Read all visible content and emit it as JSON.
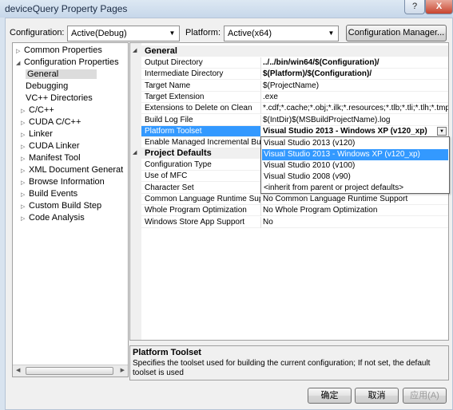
{
  "window": {
    "title": "deviceQuery Property Pages",
    "help_label": "?",
    "close_label": "X"
  },
  "toolbar": {
    "configuration_label": "Configuration:",
    "configuration_value": "Active(Debug)",
    "platform_label": "Platform:",
    "platform_value": "Active(x64)",
    "config_manager_label": "Configuration Manager..."
  },
  "tree": {
    "items": [
      {
        "label": "Common Properties",
        "expander": "▷"
      },
      {
        "label": "Configuration Properties",
        "expander": "◢"
      },
      {
        "label": "General"
      },
      {
        "label": "Debugging"
      },
      {
        "label": "VC++ Directories"
      },
      {
        "label": "C/C++",
        "expander": "▷"
      },
      {
        "label": "CUDA C/C++",
        "expander": "▷"
      },
      {
        "label": "Linker",
        "expander": "▷"
      },
      {
        "label": "CUDA Linker",
        "expander": "▷"
      },
      {
        "label": "Manifest Tool",
        "expander": "▷"
      },
      {
        "label": "XML Document Generat",
        "expander": "▷"
      },
      {
        "label": "Browse Information",
        "expander": "▷"
      },
      {
        "label": "Build Events",
        "expander": "▷"
      },
      {
        "label": "Custom Build Step",
        "expander": "▷"
      },
      {
        "label": "Code Analysis",
        "expander": "▷"
      }
    ],
    "selected": "General"
  },
  "grid": {
    "categories": [
      {
        "name": "General",
        "expander": "◢"
      },
      {
        "name": "Project Defaults",
        "expander": "◢"
      }
    ],
    "general_rows": [
      {
        "name": "Output Directory",
        "value": "../../bin/win64/$(Configuration)/"
      },
      {
        "name": "Intermediate Directory",
        "value": "$(Platform)/$(Configuration)/"
      },
      {
        "name": "Target Name",
        "value": "$(ProjectName)"
      },
      {
        "name": "Target Extension",
        "value": ".exe"
      },
      {
        "name": "Extensions to Delete on Clean",
        "value": "*.cdf;*.cache;*.obj;*.ilk;*.resources;*.tlb;*.tli;*.tlh;*.tmp;*"
      },
      {
        "name": "Build Log File",
        "value": "$(IntDir)$(MSBuildProjectName).log"
      },
      {
        "name": "Platform Toolset",
        "value": "Visual Studio 2013 - Windows XP (v120_xp)"
      },
      {
        "name": "Enable Managed Incremental Buil",
        "value": ""
      }
    ],
    "defaults_rows": [
      {
        "name": "Configuration Type",
        "value": ""
      },
      {
        "name": "Use of MFC",
        "value": ""
      },
      {
        "name": "Character Set",
        "value": ""
      },
      {
        "name": "Common Language Runtime Supp",
        "value": "No Common Language Runtime Support"
      },
      {
        "name": "Whole Program Optimization",
        "value": "No Whole Program Optimization"
      },
      {
        "name": "Windows Store App Support",
        "value": "No"
      }
    ]
  },
  "dropdown": {
    "options": [
      "Visual Studio 2013 (v120)",
      "Visual Studio 2013 - Windows XP (v120_xp)",
      "Visual Studio 2010 (v100)",
      "Visual Studio 2008 (v90)",
      "<inherit from parent or project defaults>"
    ],
    "highlighted_index": 1
  },
  "description": {
    "title": "Platform Toolset",
    "text": "Specifies the toolset used for building the current configuration; If not set, the default toolset is used"
  },
  "buttons": {
    "ok": "确定",
    "cancel": "取消",
    "apply": "应用(A)"
  },
  "colors": {
    "selection": "#3399ff",
    "tree_selection": "#dcdcdc"
  }
}
